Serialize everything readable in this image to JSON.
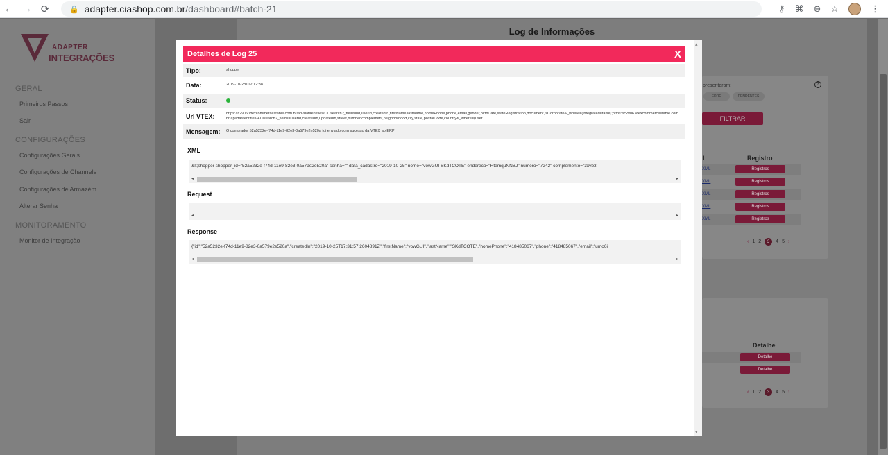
{
  "browser": {
    "url_host": "adapter.ciashop.com.br",
    "url_path": "/dashboard#batch-21",
    "back_icon": "←",
    "forward_icon": "→",
    "reload_icon": "⟳",
    "lock_icon": "🔒",
    "key_icon": "⚷",
    "translate_icon": "⌘",
    "zoom_icon": "⊖",
    "star_icon": "☆",
    "menu_icon": "⋮"
  },
  "sidebar": {
    "logo_top": "ADAPTER",
    "logo_bottom": "INTEGRAÇÕES",
    "sections": [
      {
        "title": "GERAL",
        "items": [
          "Primeiros Passos",
          "Sair"
        ]
      },
      {
        "title": "CONFIGURAÇÕES",
        "items": [
          "Configurações Gerais",
          "Configurações de Channels",
          "Configurações de Armazém",
          "Alterar Senha"
        ]
      },
      {
        "title": "MONITORAMENTO",
        "items": [
          "Monitor de Integração"
        ]
      }
    ]
  },
  "page": {
    "title": "Log de Informações",
    "filter_label": "presentaram:",
    "chips": [
      "ERRO",
      "PENDENTES"
    ],
    "filter_button": "FILTRAR",
    "help": "?",
    "table1": {
      "col_l": "L",
      "col_registro": "Registro",
      "row_link": "XML",
      "button": "Registros"
    },
    "table2": {
      "col_detalhe": "Detalhe",
      "button": "Detalhe"
    },
    "pager": {
      "prev": "‹",
      "pages": [
        "1",
        "2",
        "3",
        "4",
        "5"
      ],
      "current": "3",
      "next": "›"
    }
  },
  "modal": {
    "title": "Detalhes de Log 25",
    "close": "X",
    "fields": {
      "tipo_label": "Tipo:",
      "tipo_value": "shopper",
      "data_label": "Data:",
      "data_value": "2019-10-28T12:12:38",
      "status_label": "Status:",
      "status_color": "#2ab33a",
      "url_label": "Url VTEX:",
      "url_value": "https://c2v06.vtexcommercestable.com.br/api/dataentities/CL/search?_fields=id,userId,createdIn,firstName,lastName,homePhone,phone,email,gender,birthDate,stateRegistration,document,isCorporate&_where=(integrated=false);https://c2v06.vtexcommercestable.com.br/api/dataentities/AD/search?_fields=userId,createdIn,updatedIn,street,number,complement,neighborhood,city,state,postalCode,country&_where=(user",
      "mensagem_label": "Mensagem:",
      "mensagem_value": "O comprador 52a5232e-f74d-11e9-82e3-0a579e2e520a foi enviado com sucesso da VTEX ao ERP"
    },
    "xml_label": "XML",
    "xml_value": "&lt;shopper shopper_id=\"52a5232e-f74d-11e9-82e3-0a579e2e520a\" senha=\"\" data_cadastro=\"2019-10-25\" nome=\"vowGUI SKdTCOTE\" endereco=\"RtemquNNBJ\" numero=\"7242\" complemento=\"3xvb3",
    "request_label": "Request",
    "request_value": "",
    "response_label": "Response",
    "response_value": "{\"id\":\"52a5232e-f74d-11e9-82e3-0a579e2e520a\",\"createdIn\":\"2019-10-25T17:31:57.2604891Z\",\"firstName\":\"vowGUI\",\"lastName\":\"SKdTCOTE\",\"homePhone\":\"418485067\",\"phone\":\"418485067\",\"email\":\"umo6i",
    "scroll_left": "◂",
    "scroll_right": "▸",
    "scroll_up": "▴",
    "scroll_down": "▾"
  },
  "colors": {
    "accent": "#f2295b",
    "status_ok": "#2ab33a"
  }
}
